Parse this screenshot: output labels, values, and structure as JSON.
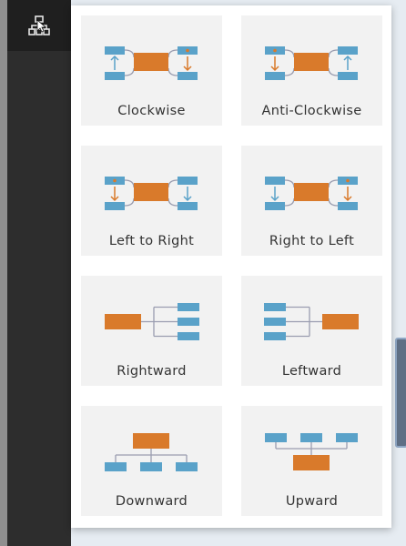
{
  "toolbar": {
    "layout_icon": "org-chart-icon"
  },
  "colors": {
    "toolbar_bg": "#2d2d2d",
    "node_blue": "#5aa2c9",
    "node_orange": "#d97a2b",
    "connector": "#9a9db0",
    "card_bg": "#f2f2f2"
  },
  "layouts": [
    {
      "label": "Clockwise",
      "icon": "clockwise-layout-icon"
    },
    {
      "label": "Anti-Clockwise",
      "icon": "anti-clockwise-layout-icon"
    },
    {
      "label": "Left to Right",
      "icon": "left-to-right-layout-icon"
    },
    {
      "label": "Right to Left",
      "icon": "right-to-left-layout-icon"
    },
    {
      "label": "Rightward",
      "icon": "rightward-layout-icon"
    },
    {
      "label": "Leftward",
      "icon": "leftward-layout-icon"
    },
    {
      "label": "Downward",
      "icon": "downward-layout-icon"
    },
    {
      "label": "Upward",
      "icon": "upward-layout-icon"
    }
  ]
}
